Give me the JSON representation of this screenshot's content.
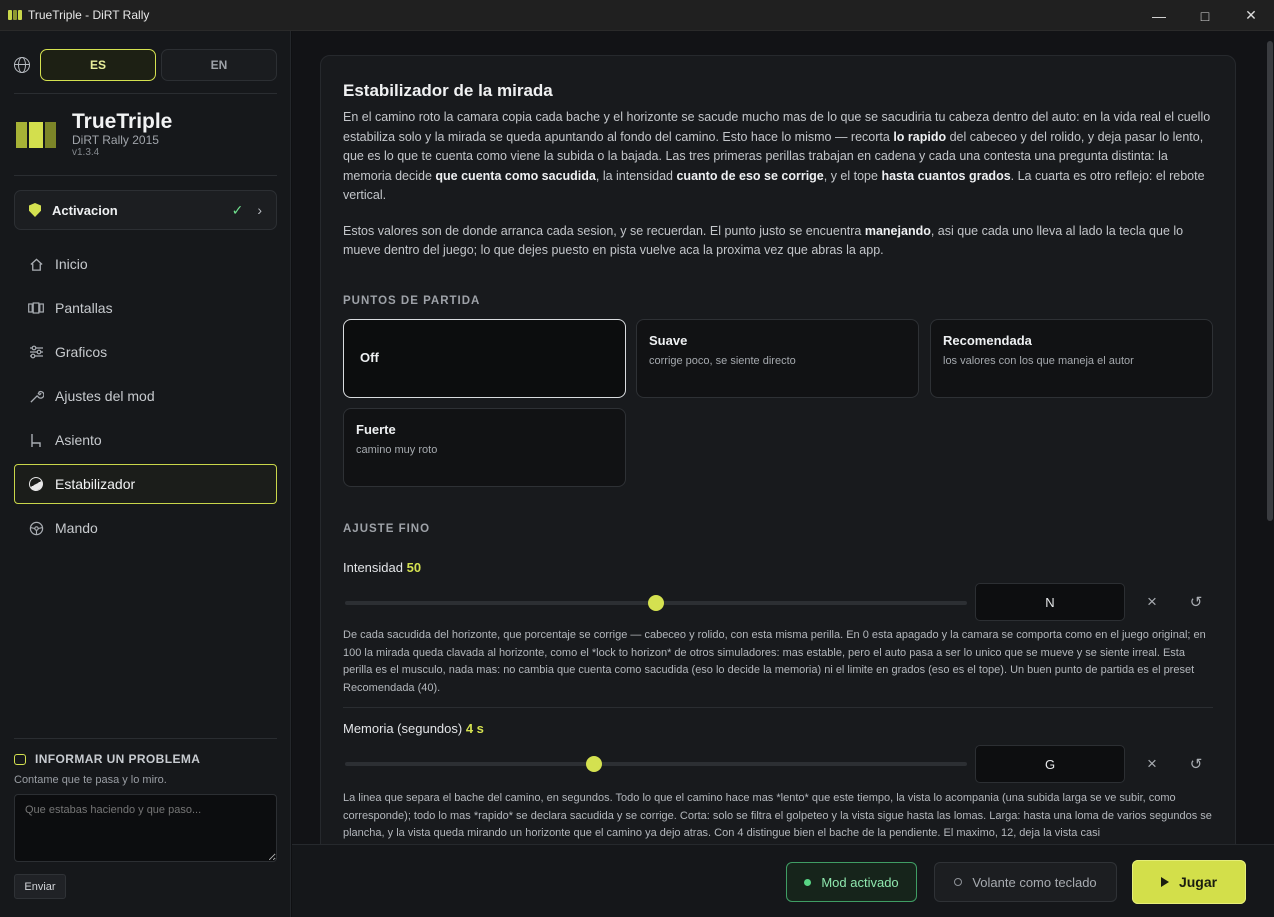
{
  "window": {
    "title": "TrueTriple - DiRT Rally"
  },
  "sidebar": {
    "lang": {
      "es": "ES",
      "en": "EN"
    },
    "brand": {
      "name": "TrueTriple",
      "game": "DiRT Rally 2015",
      "version": "v1.3.4"
    },
    "activation": {
      "label": "Activacion"
    },
    "nav": [
      {
        "label": "Inicio",
        "icon": "home-icon"
      },
      {
        "label": "Pantallas",
        "icon": "monitors-icon"
      },
      {
        "label": "Graficos",
        "icon": "sliders-icon"
      },
      {
        "label": "Ajustes del mod",
        "icon": "wrench-icon"
      },
      {
        "label": "Asiento",
        "icon": "seat-icon"
      },
      {
        "label": "Estabilizador",
        "icon": "horizon-icon",
        "active": true
      },
      {
        "label": "Mando",
        "icon": "steering-wheel-icon"
      }
    ],
    "report": {
      "title": "INFORMAR UN PROBLEMA",
      "subtitle": "Contame que te pasa y lo miro.",
      "placeholder": "Que estabas haciendo y que paso...",
      "send": "Enviar"
    }
  },
  "main": {
    "title": "Estabilizador de la mirada",
    "intro_p1": [
      "En el camino roto la camara copia cada bache y el horizonte se sacude mucho mas de lo que se sacudiria tu cabeza dentro del auto: en la vida real el cuello estabiliza solo y la mirada se queda apuntando al fondo del camino. Esto hace lo mismo — recorta ",
      "lo rapido",
      " del cabeceo y del rolido, y deja pasar lo lento, que es lo que te cuenta como viene la subida o la bajada. Las tres primeras perillas trabajan en cadena y cada una contesta una pregunta distinta: la memoria decide ",
      "que cuenta como sacudida",
      ", la intensidad ",
      "cuanto de eso se corrige",
      ", y el tope ",
      "hasta cuantos grados",
      ". La cuarta es otro reflejo: el rebote vertical."
    ],
    "intro_p2": [
      "Estos valores son de donde arranca cada sesion, y se recuerdan. El punto justo se encuentra ",
      "manejando",
      ", asi que cada uno lleva al lado la tecla que lo mueve dentro del juego; lo que dejes puesto en pista vuelve aca la proxima vez que abras la app."
    ],
    "presets_label": "PUNTOS DE PARTIDA",
    "presets": [
      {
        "title": "Off",
        "desc": "",
        "selected": true
      },
      {
        "title": "Suave",
        "desc": "corrige poco, se siente directo"
      },
      {
        "title": "Recomendada",
        "desc": "los valores con los que maneja el autor"
      },
      {
        "title": "Fuerte",
        "desc": "camino muy roto"
      }
    ],
    "fine_label": "AJUSTE FINO",
    "sliders": [
      {
        "label": "Intensidad",
        "value_text": "50",
        "fraction": 0.5,
        "key": "N",
        "desc": "De cada sacudida del horizonte, que porcentaje se corrige — cabeceo y rolido, con esta misma perilla. En 0 esta apagado y la camara se comporta como en el juego original; en 100 la mirada queda clavada al horizonte, como el *lock to horizon* de otros simuladores: mas estable, pero el auto pasa a ser lo unico que se mueve y se siente irreal. Esta perilla es el musculo, nada mas: no cambia que cuenta como sacudida (eso lo decide la memoria) ni el limite en grados (eso es el tope). Un buen punto de partida es el preset Recomendada (40)."
      },
      {
        "label": "Memoria (segundos)",
        "value_text": "4 s",
        "fraction": 0.4,
        "key": "G",
        "desc": "La linea que separa el bache del camino, en segundos. Todo lo que el camino hace mas *lento* que este tiempo, la vista lo acompania (una subida larga se ve subir, como corresponde); todo lo mas *rapido* se declara sacudida y se corrige. Corta: solo se filtra el golpeteo y la vista sigue hasta las lomas. Larga: hasta una loma de varios segundos se plancha, y la vista queda mirando un horizonte que el camino ya dejo atras. Con 4 distingue bien el bache de la pendiente. El maximo, 12, deja la vista casi"
      }
    ]
  },
  "footer": {
    "mod": "Mod activado",
    "wheel": "Volante como teclado",
    "play": "Jugar"
  },
  "colors": {
    "accent": "#d4e150",
    "ok": "#58d585",
    "bg": "#121316"
  }
}
